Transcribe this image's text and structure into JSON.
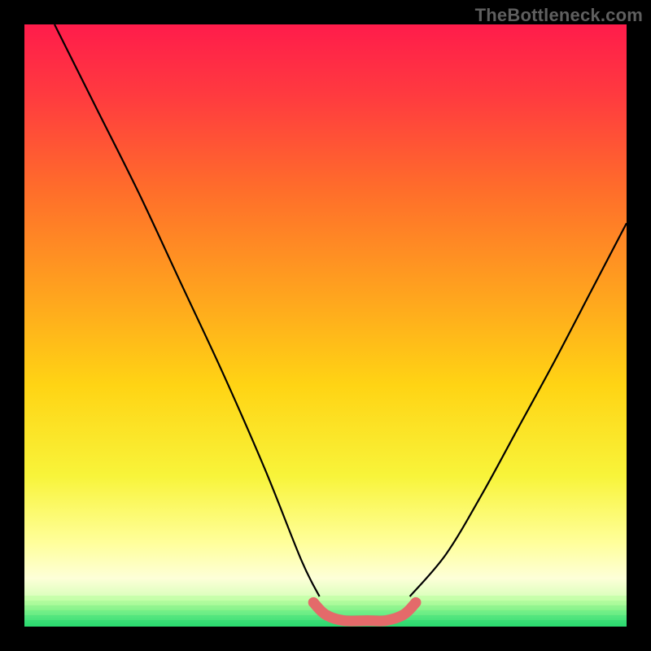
{
  "attribution": "TheBottleneck.com",
  "chart_data": {
    "type": "line",
    "title": "",
    "xlabel": "",
    "ylabel": "",
    "xlim": [
      0,
      1
    ],
    "ylim": [
      0,
      1
    ],
    "series": [
      {
        "name": "bottleneck-curve-left",
        "x": [
          0.05,
          0.12,
          0.19,
          0.26,
          0.33,
          0.4,
          0.46,
          0.49
        ],
        "y": [
          1.0,
          0.86,
          0.72,
          0.57,
          0.42,
          0.26,
          0.11,
          0.05
        ]
      },
      {
        "name": "bottleneck-curve-right",
        "x": [
          0.64,
          0.7,
          0.76,
          0.82,
          0.88,
          0.94,
          1.0
        ],
        "y": [
          0.05,
          0.12,
          0.22,
          0.33,
          0.44,
          0.555,
          0.67
        ]
      },
      {
        "name": "optimal-band",
        "x": [
          0.48,
          0.5,
          0.53,
          0.57,
          0.6,
          0.63,
          0.65
        ],
        "y": [
          0.04,
          0.02,
          0.01,
          0.01,
          0.01,
          0.02,
          0.04
        ]
      }
    ],
    "background_gradient": {
      "stops": [
        {
          "offset": 0.0,
          "color": "#ff1c4b"
        },
        {
          "offset": 0.12,
          "color": "#ff3b3f"
        },
        {
          "offset": 0.28,
          "color": "#ff6f2a"
        },
        {
          "offset": 0.45,
          "color": "#ffa41e"
        },
        {
          "offset": 0.6,
          "color": "#ffd414"
        },
        {
          "offset": 0.75,
          "color": "#f8f43a"
        },
        {
          "offset": 0.86,
          "color": "#ffff9a"
        },
        {
          "offset": 0.92,
          "color": "#fdffd8"
        },
        {
          "offset": 0.955,
          "color": "#d6ffb8"
        },
        {
          "offset": 0.975,
          "color": "#86f59a"
        },
        {
          "offset": 1.0,
          "color": "#29d96e"
        }
      ]
    },
    "optimal_band_color": "#e46a6a",
    "curve_color": "#000000"
  }
}
